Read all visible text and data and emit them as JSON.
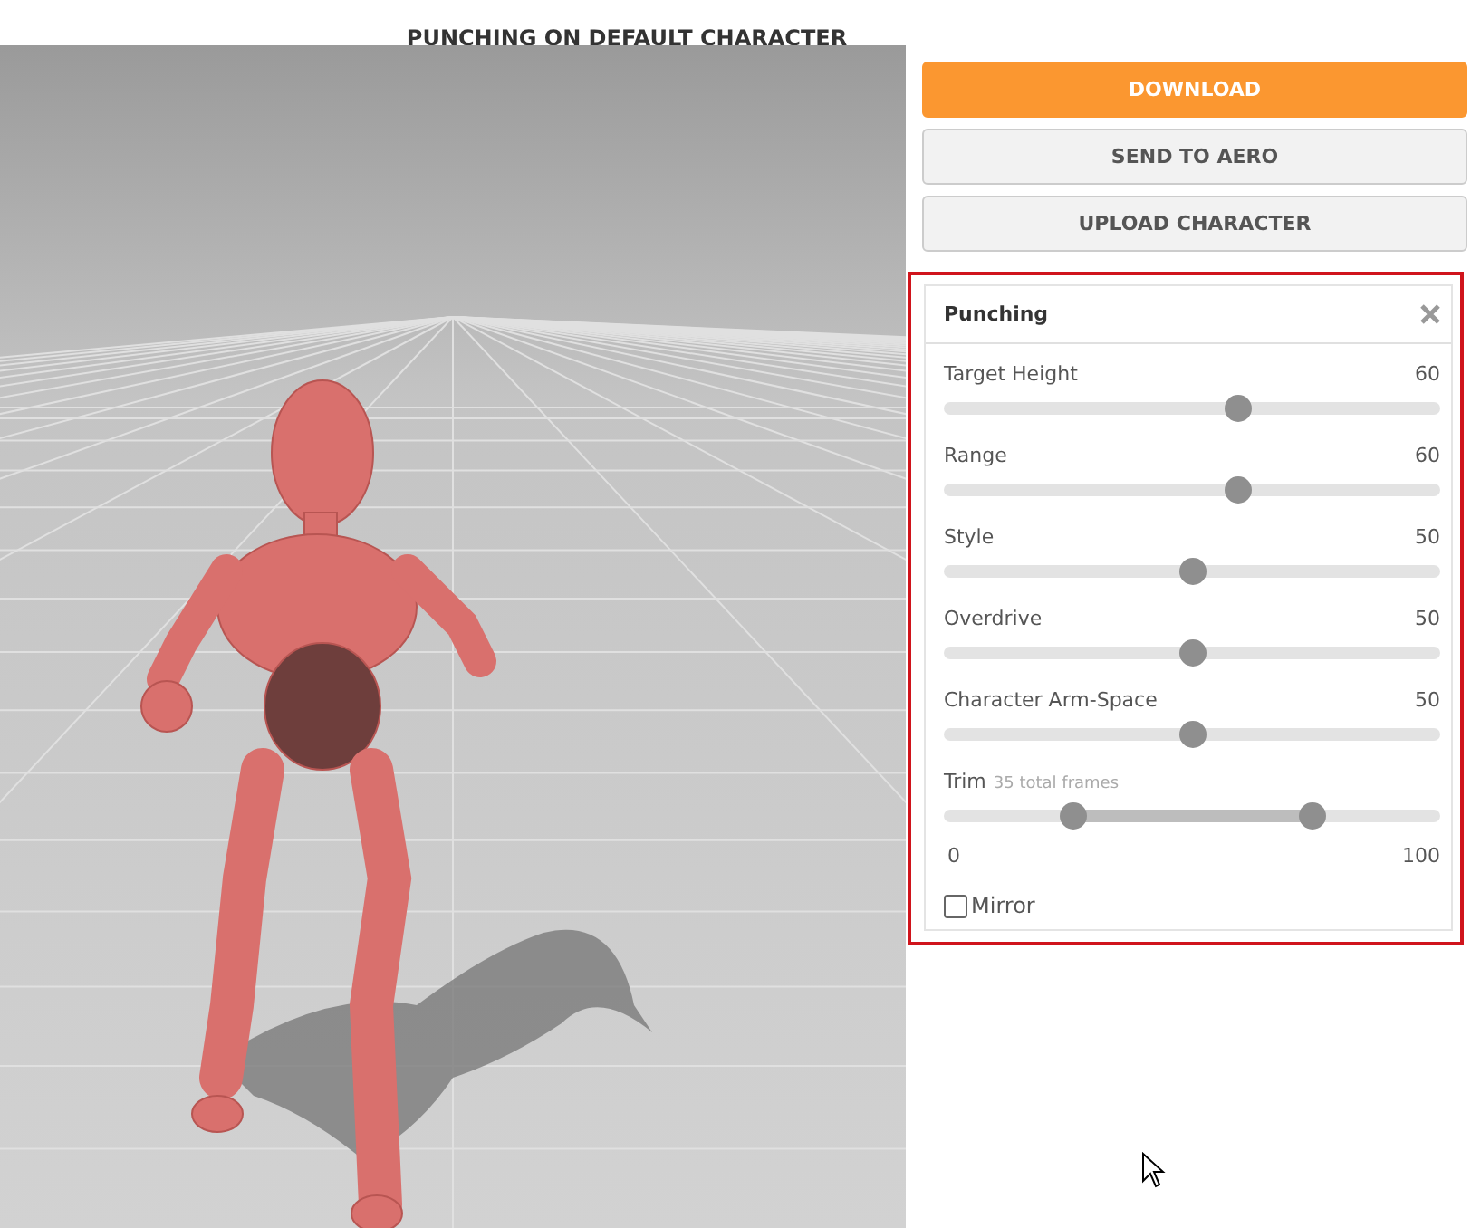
{
  "header": {
    "title": "PUNCHING ON DEFAULT CHARACTER"
  },
  "buttons": [
    {
      "label": "DOWNLOAD",
      "kind": "primary"
    },
    {
      "label": "SEND TO AERO",
      "kind": "secondary"
    },
    {
      "label": "UPLOAD CHARACTER",
      "kind": "secondary"
    }
  ],
  "panel": {
    "title": "Punching",
    "sliders": [
      {
        "name": "Target Height",
        "reading": "60",
        "level": 0.59
      },
      {
        "name": "Range",
        "reading": "60",
        "level": 0.59
      },
      {
        "name": "Style",
        "reading": "50",
        "level": 0.5
      },
      {
        "name": "Overdrive",
        "reading": "50",
        "level": 0.5
      },
      {
        "name": "Character Arm-Space",
        "reading": "50",
        "level": 0.5
      }
    ],
    "trim": {
      "name": "Trim",
      "note": "35 total frames",
      "start": {
        "level": 0.26
      },
      "end": {
        "level": 0.74
      },
      "min_label": "0",
      "max_label": "100"
    },
    "mirror": {
      "label": "Mirror",
      "checked": false
    }
  }
}
